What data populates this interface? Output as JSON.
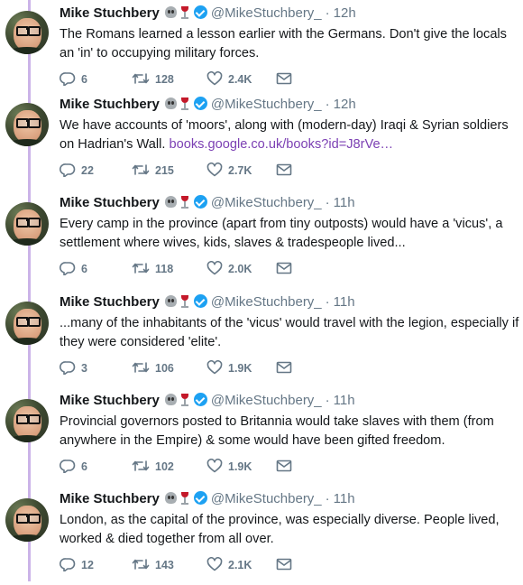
{
  "author": {
    "name": "Mike Stuchbery",
    "handle": "@MikeStuchbery_",
    "emoji": [
      "skull-icon",
      "wine-glass-icon"
    ],
    "verified": true
  },
  "colors": {
    "thread_line": "#cbb3e8",
    "verified": "#1da1f2",
    "link": "#7b3fb3",
    "muted": "#657786"
  },
  "tweets": [
    {
      "time": "12h",
      "text": "The Romans learned a lesson earlier with the Germans. Don't give the locals an 'in' to occupying military forces.",
      "link": "",
      "replies": "6",
      "retweets": "128",
      "likes": "2.4K"
    },
    {
      "time": "12h",
      "text": "We have accounts of 'moors', along with (modern-day) Iraqi & Syrian soldiers on Hadrian's Wall. ",
      "link": "books.google.co.uk/books?id=J8rVe…",
      "replies": "22",
      "retweets": "215",
      "likes": "2.7K"
    },
    {
      "time": "11h",
      "text": "Every camp in the province (apart from tiny outposts) would have a 'vicus', a settlement where wives, kids, slaves & tradespeople lived...",
      "link": "",
      "replies": "6",
      "retweets": "118",
      "likes": "2.0K"
    },
    {
      "time": "11h",
      "text": "...many of the inhabitants of the 'vicus' would travel with the legion, especially if they were considered 'elite'.",
      "link": "",
      "replies": "3",
      "retweets": "106",
      "likes": "1.9K"
    },
    {
      "time": "11h",
      "text": "Provincial governors posted to Britannia would take slaves with them (from anywhere in the Empire) & some would have been gifted freedom.",
      "link": "",
      "replies": "6",
      "retweets": "102",
      "likes": "1.9K"
    },
    {
      "time": "11h",
      "text": "London, as the capital of the province, was especially diverse. People lived, worked & died together from all over.",
      "link": "",
      "replies": "12",
      "retweets": "143",
      "likes": "2.1K"
    }
  ]
}
